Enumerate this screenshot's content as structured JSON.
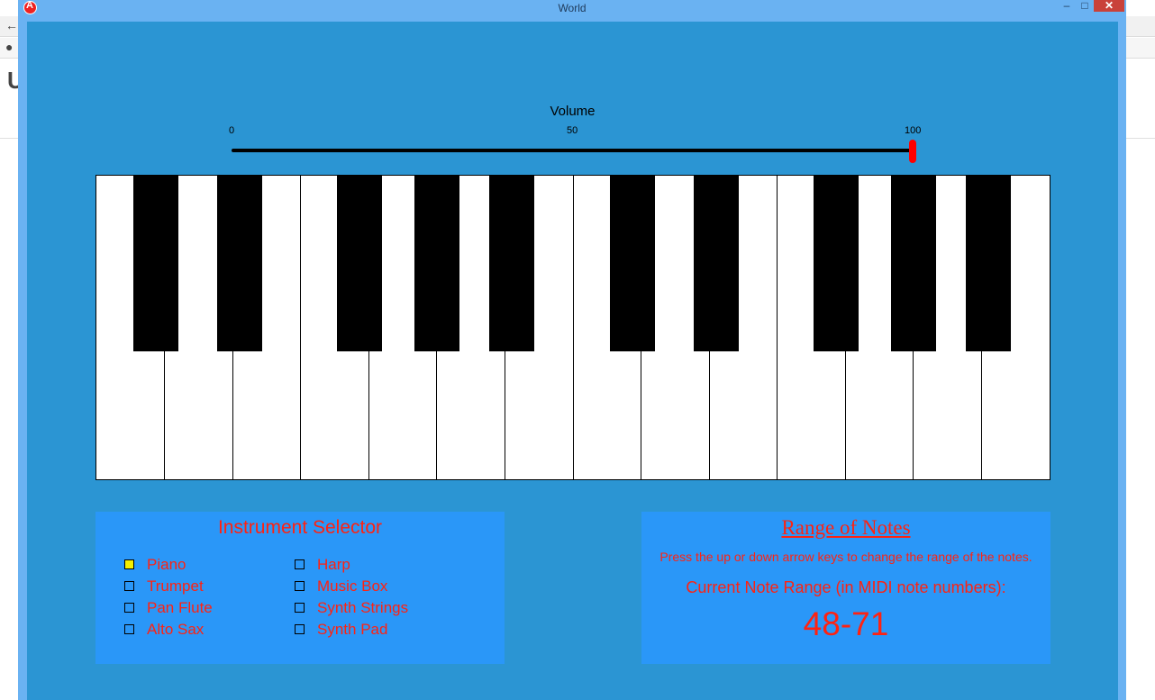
{
  "window": {
    "title": "World"
  },
  "volume": {
    "title": "Volume",
    "ticks": [
      "0",
      "50",
      "100"
    ],
    "value": 100,
    "min": 0,
    "max": 100
  },
  "keyboard": {
    "white_keys": 14,
    "black_keys": 10
  },
  "instrument_selector": {
    "title": "Instrument Selector",
    "options": [
      {
        "label": "Piano",
        "checked": true
      },
      {
        "label": "Trumpet",
        "checked": false
      },
      {
        "label": "Pan Flute",
        "checked": false
      },
      {
        "label": "Alto Sax",
        "checked": false
      },
      {
        "label": "Harp",
        "checked": false
      },
      {
        "label": "Music Box",
        "checked": false
      },
      {
        "label": "Synth Strings",
        "checked": false
      },
      {
        "label": "Synth Pad",
        "checked": false
      }
    ]
  },
  "range_of_notes": {
    "title": "Range of Notes",
    "hint": "Press the up or down arrow keys to change the range of the notes.",
    "label": "Current Note Range (in MIDI note numbers):",
    "value": "48-71"
  },
  "colors": {
    "client_bg": "#2b95d3",
    "panel_bg": "#2a97f8",
    "accent_text": "#ff2211",
    "selected_checkbox": "#f4f000",
    "slider_thumb": "#ff0000"
  }
}
